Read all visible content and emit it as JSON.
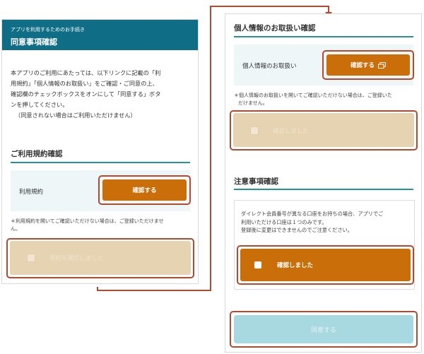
{
  "left": {
    "header_sub": "アプリを利用するためのお手続き",
    "header_title": "同意事項確認",
    "intro_lines": [
      "本アプリのご利用にあたっては、以下リンクに記載の「利",
      "用規約」「個人情報のお取扱い」をご確認・ご同意の上、",
      "確認欄のチェックボックスをオンにして「同意する」ボタ",
      "ンを押してください。",
      "（同意されない場合はご利用いただけません）"
    ],
    "terms_section_title": "ご利用規約確認",
    "terms_label": "利用規約",
    "terms_button": "確認する",
    "terms_note_lines": [
      "＊利用規約を開いてご確認いただけない場合は、ご登録いただけませ",
      "ん。"
    ],
    "terms_checkbox_label": "規約を確認しました"
  },
  "right": {
    "privacy_section_title": "個人情報のお取扱い確認",
    "privacy_label": "個人情報のお取扱い",
    "privacy_button": "確認する",
    "privacy_note_lines": [
      "＊個人情報のお取扱いを開いてご確認いただけない場合は、ご登録いた",
      "だけません。"
    ],
    "privacy_checkbox_label": "確認しました",
    "caution_section_title": "注意事項確認",
    "caution_lines": [
      "ダイレクト会員番号が異なる口座をお持ちの場合、アプリでご",
      "利用いただける口座は１つのみです。",
      "登録後に変更はできませんのでご注意ください。"
    ],
    "caution_checkbox_label": "確認しました",
    "agree_button": "同意する"
  },
  "colors": {
    "header": "#0f6e86",
    "accent": "#c96e08",
    "highlight": "#b14a2e",
    "agree_disabled": "#a8d8e0"
  },
  "icons": {
    "privacy_button_icon": "external-window-icon",
    "connector_arrow": "arrow-down-icon"
  }
}
